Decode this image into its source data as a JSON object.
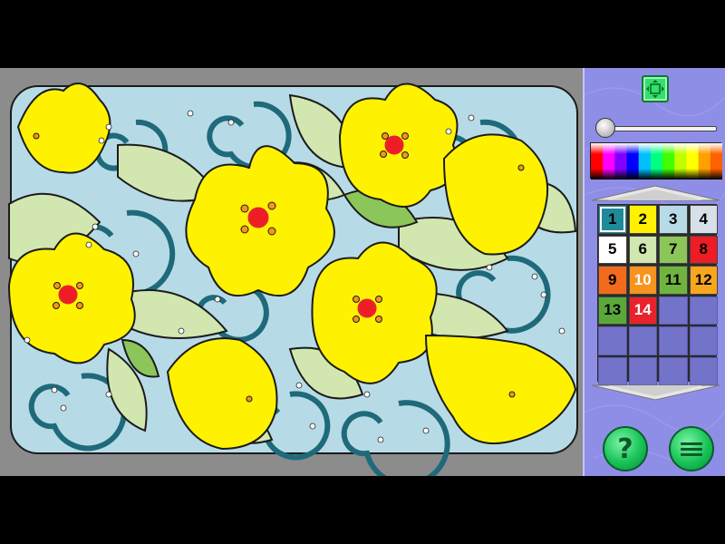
{
  "colors": {
    "background": "#8c8c8c",
    "panel": "#8f8ee6",
    "accent_green": "#32e06a",
    "flower_yellow": "#fff200",
    "leaf_green": "#d2e6b0",
    "swirl_blue": "#b7dbe6"
  },
  "toolbar": {
    "fit_icon": "fit-to-screen-icon",
    "zoom_level": 0.0
  },
  "palette_strip": {
    "hues": [
      "#ff0000",
      "#ff00ff",
      "#8000ff",
      "#0000ff",
      "#00c0ff",
      "#00ff80",
      "#40ff00",
      "#c0ff00",
      "#ffff00",
      "#ffa000",
      "#ff6000"
    ]
  },
  "numbers": [
    {
      "label": "1",
      "color": "#1f8a9a",
      "selected": true
    },
    {
      "label": "2",
      "color": "#fff200"
    },
    {
      "label": "3",
      "color": "#b7dbe6"
    },
    {
      "label": "4",
      "color": "#d7dfe8"
    },
    {
      "label": "5",
      "color": "#ffffff"
    },
    {
      "label": "6",
      "color": "#d2e6b0"
    },
    {
      "label": "7",
      "color": "#8cc65a"
    },
    {
      "label": "8",
      "color": "#ee1c25"
    },
    {
      "label": "9",
      "color": "#f26b1d"
    },
    {
      "label": "10",
      "color": "#f7941d",
      "text_color": "#ffffff"
    },
    {
      "label": "11",
      "color": "#6fb43f"
    },
    {
      "label": "12",
      "color": "#f7a61d"
    },
    {
      "label": "13",
      "color": "#5ba83a"
    },
    {
      "label": "14",
      "color": "#e8232b",
      "text_color": "#ffffff"
    }
  ],
  "empty_slots": 10,
  "buttons": {
    "help_icon": "help-icon",
    "help_glyph": "?",
    "menu_icon": "menu-icon"
  }
}
